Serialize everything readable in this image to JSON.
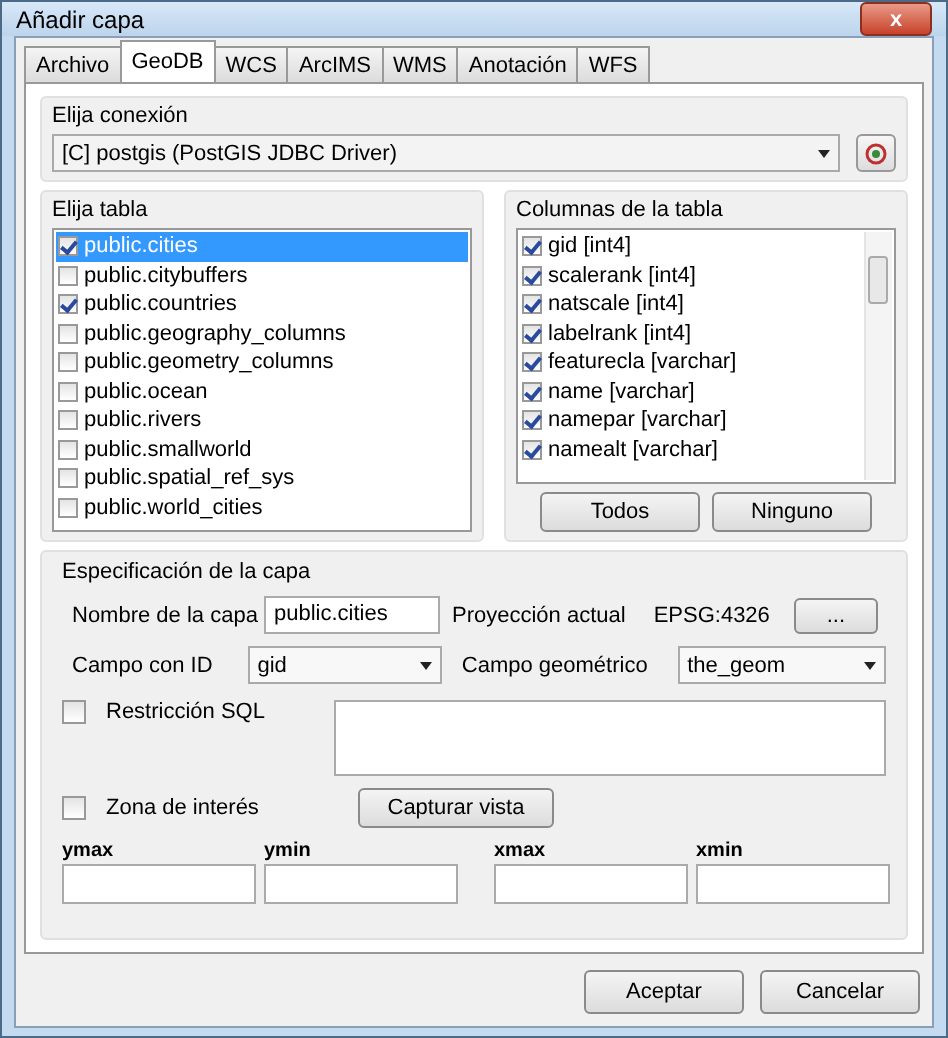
{
  "window": {
    "title": "Añadir capa",
    "close": "x"
  },
  "tabs": [
    {
      "label": "Archivo",
      "selected": false
    },
    {
      "label": "GeoDB",
      "selected": true
    },
    {
      "label": "WCS",
      "selected": false
    },
    {
      "label": "ArcIMS",
      "selected": false
    },
    {
      "label": "WMS",
      "selected": false
    },
    {
      "label": "Anotación",
      "selected": false
    },
    {
      "label": "WFS",
      "selected": false
    }
  ],
  "connection": {
    "label": "Elija conexión",
    "value": "[C] postgis (PostGIS JDBC Driver)"
  },
  "tables": {
    "label": "Elija tabla",
    "items": [
      {
        "name": "public.cities",
        "checked": true,
        "selected": true
      },
      {
        "name": "public.citybuffers",
        "checked": false,
        "selected": false
      },
      {
        "name": "public.countries",
        "checked": true,
        "selected": false
      },
      {
        "name": "public.geography_columns",
        "checked": false,
        "selected": false
      },
      {
        "name": "public.geometry_columns",
        "checked": false,
        "selected": false
      },
      {
        "name": "public.ocean",
        "checked": false,
        "selected": false
      },
      {
        "name": "public.rivers",
        "checked": false,
        "selected": false
      },
      {
        "name": "public.smallworld",
        "checked": false,
        "selected": false
      },
      {
        "name": "public.spatial_ref_sys",
        "checked": false,
        "selected": false
      },
      {
        "name": "public.world_cities",
        "checked": false,
        "selected": false
      }
    ]
  },
  "columns": {
    "label": "Columnas de la tabla",
    "items": [
      {
        "name": "gid [int4]",
        "checked": true
      },
      {
        "name": "scalerank [int4]",
        "checked": true
      },
      {
        "name": "natscale [int4]",
        "checked": true
      },
      {
        "name": "labelrank [int4]",
        "checked": true
      },
      {
        "name": "featurecla [varchar]",
        "checked": true
      },
      {
        "name": "name [varchar]",
        "checked": true
      },
      {
        "name": "namepar [varchar]",
        "checked": true
      },
      {
        "name": "namealt [varchar]",
        "checked": true
      }
    ],
    "buttons": [
      "Todos",
      "Ninguno"
    ]
  },
  "spec": {
    "label": "Especificación de la capa",
    "layer_name_label": "Nombre de la capa",
    "layer_name": "public.cities",
    "projection_label": "Proyección actual",
    "projection": "EPSG:4326",
    "projection_button": "...",
    "id_label": "Campo con ID",
    "id_value": "gid",
    "geom_label": "Campo geométrico",
    "geom_value": "the_geom",
    "sql": {
      "label": "Restricción SQL",
      "checked": false
    },
    "zone": {
      "label": "Zona de interés",
      "checked": false
    },
    "capture_button": "Capturar vista",
    "bounds": [
      "ymax",
      "ymin",
      "xmax",
      "xmin"
    ]
  },
  "buttons": [
    "Aceptar",
    "Cancelar"
  ]
}
